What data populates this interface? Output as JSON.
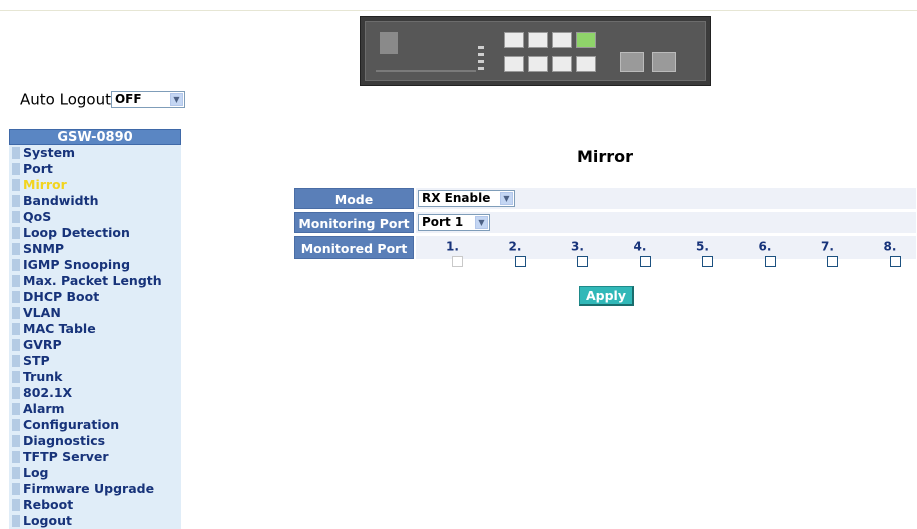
{
  "auto_logout": {
    "label": "Auto Logout",
    "value": "OFF"
  },
  "sidebar": {
    "title": "GSW-0890",
    "items": [
      {
        "label": "System"
      },
      {
        "label": "Port"
      },
      {
        "label": "Mirror"
      },
      {
        "label": "Bandwidth"
      },
      {
        "label": "QoS"
      },
      {
        "label": "Loop Detection"
      },
      {
        "label": "SNMP"
      },
      {
        "label": "IGMP Snooping"
      },
      {
        "label": "Max. Packet Length"
      },
      {
        "label": "DHCP Boot"
      },
      {
        "label": "VLAN"
      },
      {
        "label": "MAC Table"
      },
      {
        "label": "GVRP"
      },
      {
        "label": "STP"
      },
      {
        "label": "Trunk"
      },
      {
        "label": "802.1X"
      },
      {
        "label": "Alarm"
      },
      {
        "label": "Configuration"
      },
      {
        "label": "Diagnostics"
      },
      {
        "label": "TFTP Server"
      },
      {
        "label": "Log"
      },
      {
        "label": "Firmware Upgrade"
      },
      {
        "label": "Reboot"
      },
      {
        "label": "Logout"
      }
    ],
    "active_item": "Mirror"
  },
  "page": {
    "title": "Mirror"
  },
  "form": {
    "mode_label": "Mode",
    "mode_value": "RX Enable",
    "monitoring_label": "Monitoring Port",
    "monitoring_value": "Port 1",
    "monitored_label": "Monitored Port",
    "ports": [
      {
        "label": "1.",
        "checked": false,
        "disabled": true
      },
      {
        "label": "2.",
        "checked": false,
        "disabled": false
      },
      {
        "label": "3.",
        "checked": false,
        "disabled": false
      },
      {
        "label": "4.",
        "checked": false,
        "disabled": false
      },
      {
        "label": "5.",
        "checked": false,
        "disabled": false
      },
      {
        "label": "6.",
        "checked": false,
        "disabled": false
      },
      {
        "label": "7.",
        "checked": false,
        "disabled": false
      },
      {
        "label": "8.",
        "checked": false,
        "disabled": false
      }
    ]
  },
  "apply_button": {
    "label": "Apply"
  },
  "colors": {
    "sidebar_title_bg": "#5a86c3",
    "sidebar_item_bg": "#e0edf8",
    "active_item_text": "#f2d41e",
    "label_bg": "#5a7fb8",
    "apply_bg": "#31b8b8"
  }
}
